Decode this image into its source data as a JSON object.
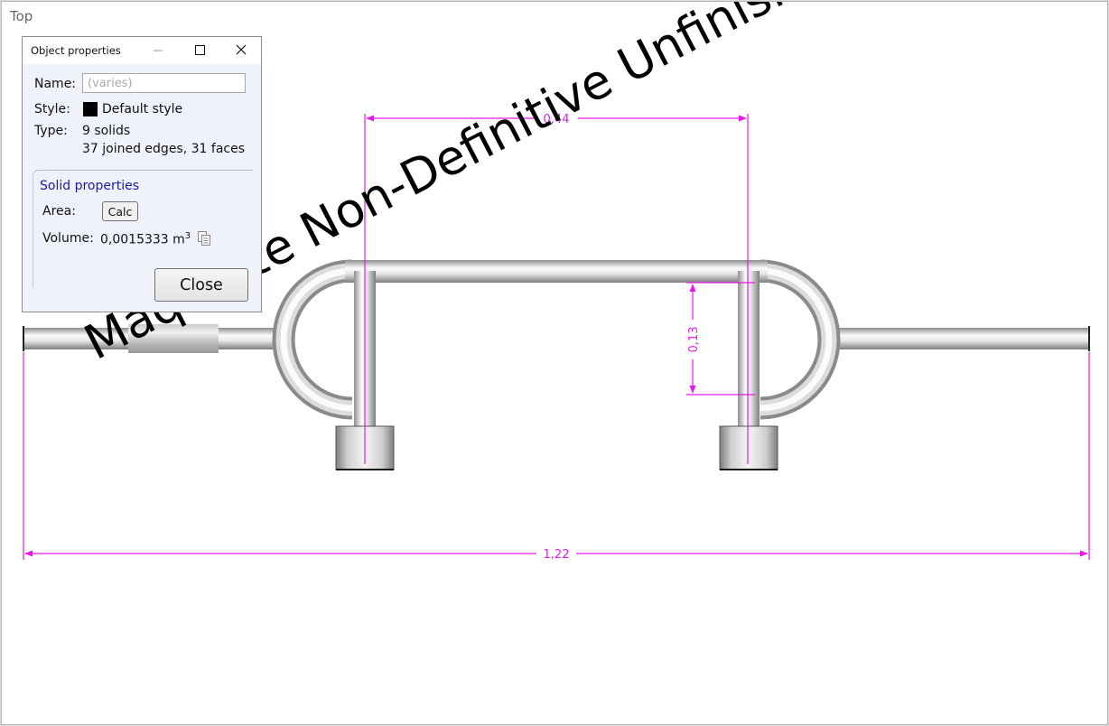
{
  "view": {
    "label": "Top"
  },
  "dimensions": {
    "d1": "0,44",
    "d2": "0,13",
    "d3": "1,22"
  },
  "watermark": "Maquette Non-Definitive Unfinished Model",
  "colors": {
    "dimension": "#e619e6",
    "tube_light": "#fafafa",
    "tube_dark": "#8a8a8a",
    "dialog_bg": "#eff2fb",
    "group_title": "#1a1aa6"
  },
  "dialog": {
    "title": "Object properties",
    "controls": {
      "minimize": "minimize-icon",
      "maximize": "maximize-icon",
      "close": "close-icon"
    },
    "name_label": "Name:",
    "name_placeholder": "(varies)",
    "style_label": "Style:",
    "style_value": "Default style",
    "type_label": "Type:",
    "type_line1": "9 solids",
    "type_line2": "37 joined edges, 31 faces",
    "solid_group_title": "Solid properties",
    "area_label": "Area:",
    "calc_label": "Calc",
    "volume_label": "Volume:",
    "volume_value": "0,0015333 m",
    "volume_exp": "3",
    "copy_icon": "copy-icon",
    "close_label": "Close"
  }
}
